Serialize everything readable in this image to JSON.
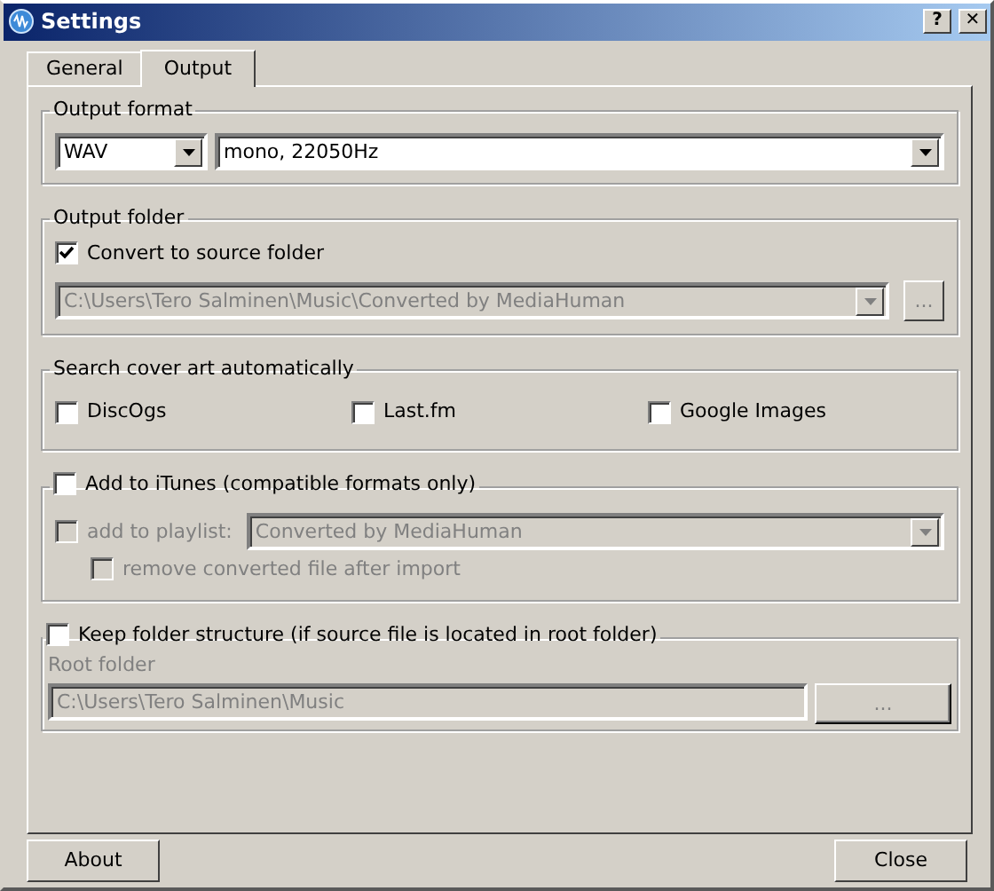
{
  "window": {
    "title": "Settings",
    "help_button": "?",
    "close_button": "✕"
  },
  "tabs": [
    {
      "label": "General",
      "selected": false
    },
    {
      "label": "Output",
      "selected": true
    }
  ],
  "output_format": {
    "legend": "Output format",
    "format": "WAV",
    "quality": "mono, 22050Hz"
  },
  "output_folder": {
    "legend": "Output folder",
    "convert_to_source": {
      "label": "Convert to source folder",
      "checked": true,
      "disabled": false
    },
    "path": "C:\\Users\\Tero Salminen\\Music\\Converted by MediaHuman",
    "path_disabled": true,
    "browse": "..."
  },
  "cover_art": {
    "legend": "Search cover art automatically",
    "sources": [
      {
        "label": "DiscOgs",
        "checked": false,
        "disabled": false
      },
      {
        "label": "Last.fm",
        "checked": false,
        "disabled": false
      },
      {
        "label": "Google Images",
        "checked": false,
        "disabled": false
      }
    ]
  },
  "itunes": {
    "toggle": {
      "label": "Add to iTunes (compatible formats only)",
      "checked": false,
      "disabled": false
    },
    "add_to_playlist": {
      "label": "add to playlist:",
      "checked": false,
      "disabled": true
    },
    "playlist": "Converted by MediaHuman",
    "remove_after_import": {
      "label": "remove converted file after import",
      "checked": false,
      "disabled": true
    }
  },
  "folder_structure": {
    "toggle": {
      "label": "Keep folder structure (if source file is located in root folder)",
      "checked": false,
      "disabled": false
    },
    "root_folder_label": "Root folder",
    "root_folder": "C:\\Users\\Tero Salminen\\Music",
    "browse": "..."
  },
  "buttons": [
    "About",
    "Close"
  ]
}
